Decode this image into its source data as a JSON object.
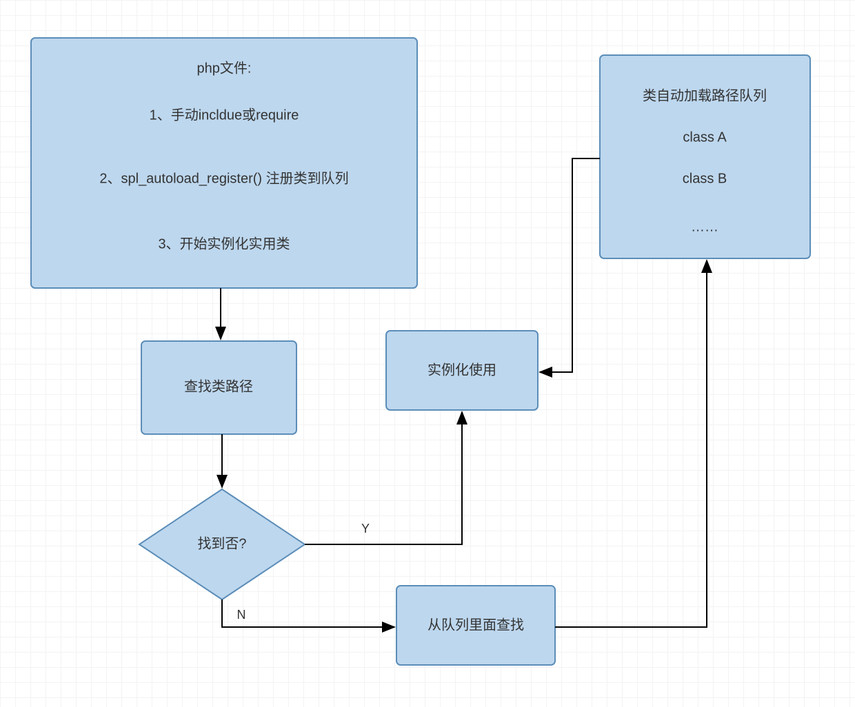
{
  "nodes": {
    "php_file": {
      "title": "php文件:",
      "line1": "1、手动incldue或require",
      "line2": "2、spl_autoload_register() 注册类到队列",
      "line3": "3、开始实例化实用类"
    },
    "queue_list": {
      "title": "类自动加载路径队列",
      "item1": "class A",
      "item2": "class B",
      "item3": "……"
    },
    "find_path": "查找类路径",
    "found_q": "找到否?",
    "instantiate": "实例化使用",
    "search_queue": "从队列里面查找"
  },
  "edges": {
    "yes": "Y",
    "no": "N"
  }
}
